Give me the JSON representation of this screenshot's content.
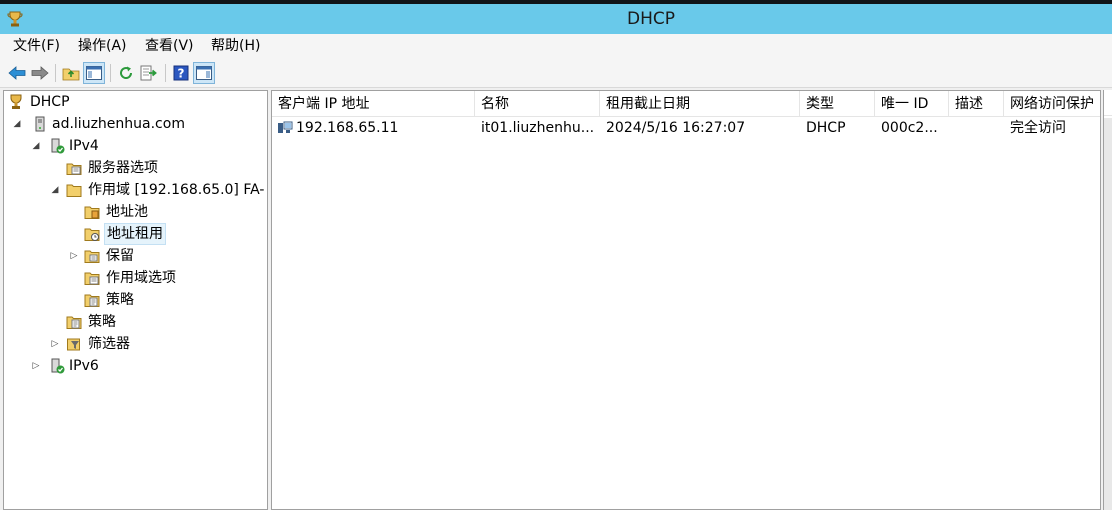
{
  "window": {
    "title": "DHCP"
  },
  "menu": [
    "文件(F)",
    "操作(A)",
    "查看(V)",
    "帮助(H)"
  ],
  "toolbar": {
    "icons": [
      "back-arrow-icon",
      "forward-arrow-icon",
      "up-folder-icon",
      "show-hide-tree-icon",
      "refresh-icon",
      "export-list-icon",
      "help-icon",
      "show-hide-action-pane-icon"
    ]
  },
  "tree": {
    "root": "DHCP",
    "server": "ad.liuzhenhua.com",
    "ipv4": "IPv4",
    "server_options": "服务器选项",
    "scope": "作用域 [192.168.65.0] FA-",
    "address_pool": "地址池",
    "address_leases": "地址租用",
    "reservations": "保留",
    "scope_options": "作用域选项",
    "scope_policies": "策略",
    "policies": "策略",
    "filters": "筛选器",
    "ipv6": "IPv6"
  },
  "table": {
    "columns": [
      "客户端 IP 地址",
      "名称",
      "租用截止日期",
      "类型",
      "唯一 ID",
      "描述",
      "网络访问保护"
    ],
    "rows": [
      [
        "192.168.65.11",
        "it01.liuzhenhu...",
        "2024/5/16 16:27:07",
        "DHCP",
        "000c2...",
        "",
        "完全访问"
      ]
    ]
  },
  "colors": {
    "titlebar": "#69c9ea",
    "selection": "#e5f3fb",
    "panel_border": "#a0a0a0"
  }
}
